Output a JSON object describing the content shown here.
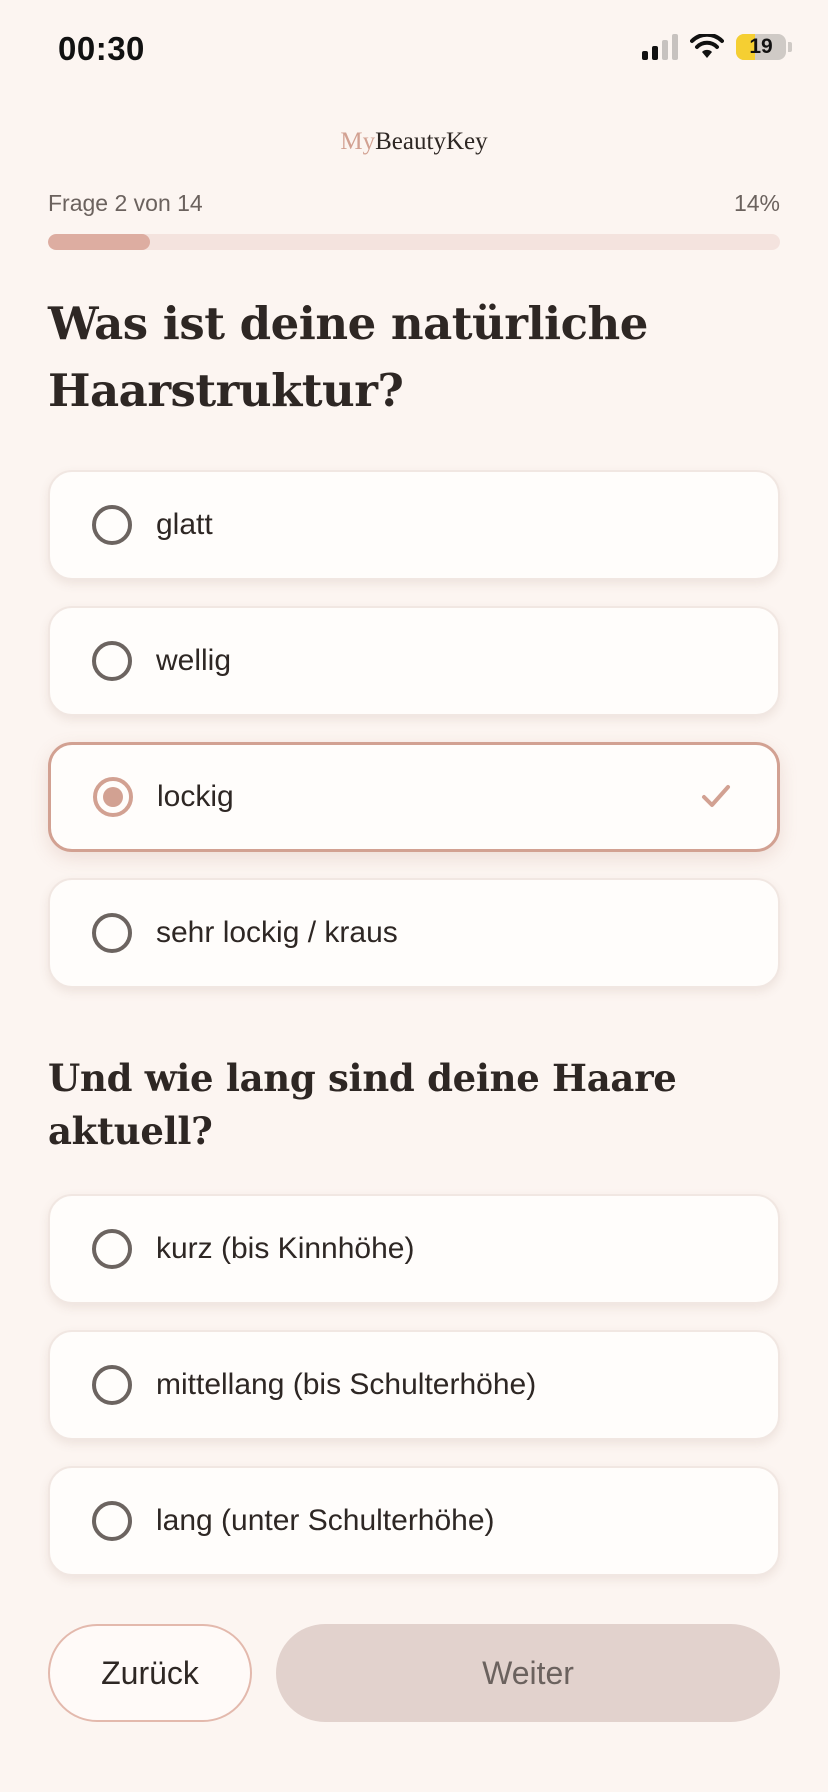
{
  "status_bar": {
    "time": "00:30",
    "battery": "19",
    "icons": [
      "signal-icon",
      "wifi-icon",
      "battery-icon"
    ]
  },
  "brand": {
    "prefix": "My",
    "name": "BeautyKey"
  },
  "progress": {
    "label": "Frage 2 von 14",
    "percent_label": "14%",
    "fraction": 0.14
  },
  "question1": {
    "title": "Was ist deine natürliche Haarstruktur?",
    "options": [
      {
        "label": "glatt",
        "selected": false
      },
      {
        "label": "wellig",
        "selected": false
      },
      {
        "label": "lockig",
        "selected": true
      },
      {
        "label": "sehr lockig / kraus",
        "selected": false
      }
    ]
  },
  "question2": {
    "title": "Und wie lang sind deine Haare aktuell?",
    "options": [
      {
        "label": "kurz (bis Kinnhöhe)",
        "selected": false
      },
      {
        "label": "mittellang (bis Schulterhöhe)",
        "selected": false
      },
      {
        "label": "lang (unter Schulterhöhe)",
        "selected": false
      }
    ]
  },
  "buttons": {
    "back": "Zurück",
    "next": "Weiter",
    "next_enabled": false
  },
  "colors": {
    "accent": "#d2a192",
    "background": "#fcf5f1",
    "disabled_button": "#e2d2cd",
    "battery": "#f5cf32"
  }
}
